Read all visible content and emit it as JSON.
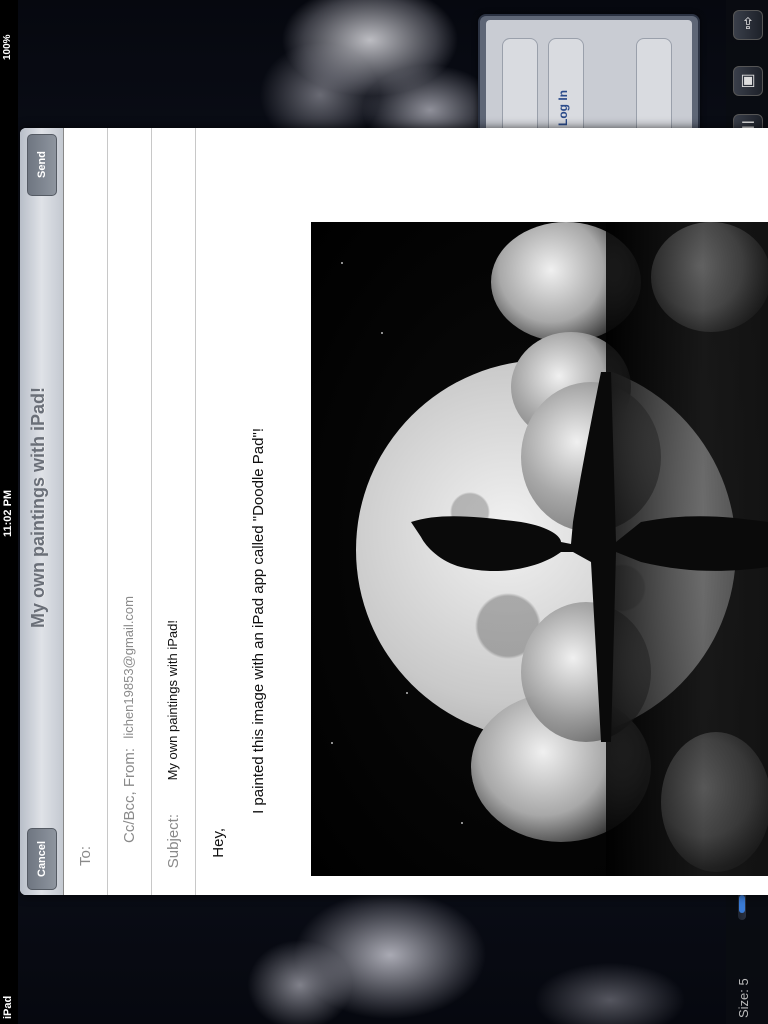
{
  "status_bar": {
    "battery": "100%",
    "time": "11:02 PM",
    "carrier": "iPad"
  },
  "toolbar": {
    "size_label": "Size: 5"
  },
  "popover": {
    "login_label": "Log In"
  },
  "compose": {
    "title": "My own paintings with iPad!",
    "cancel_label": "Cancel",
    "send_label": "Send",
    "to_label": "To:",
    "ccbcc_label": "Cc/Bcc, From:",
    "from_value": "lichen19853@gmail.com",
    "subject_label": "Subject:",
    "subject_value": "My own paintings with iPad!",
    "body_greeting": "Hey,",
    "body_text": "I painted this image with an iPad app called \"Doodle Pad\"!"
  },
  "colors": {
    "nav_bar": "#c9cdd4",
    "sheet": "#ffffff",
    "toolbar": "#0a0c12",
    "accent": "#3a7bd5"
  }
}
